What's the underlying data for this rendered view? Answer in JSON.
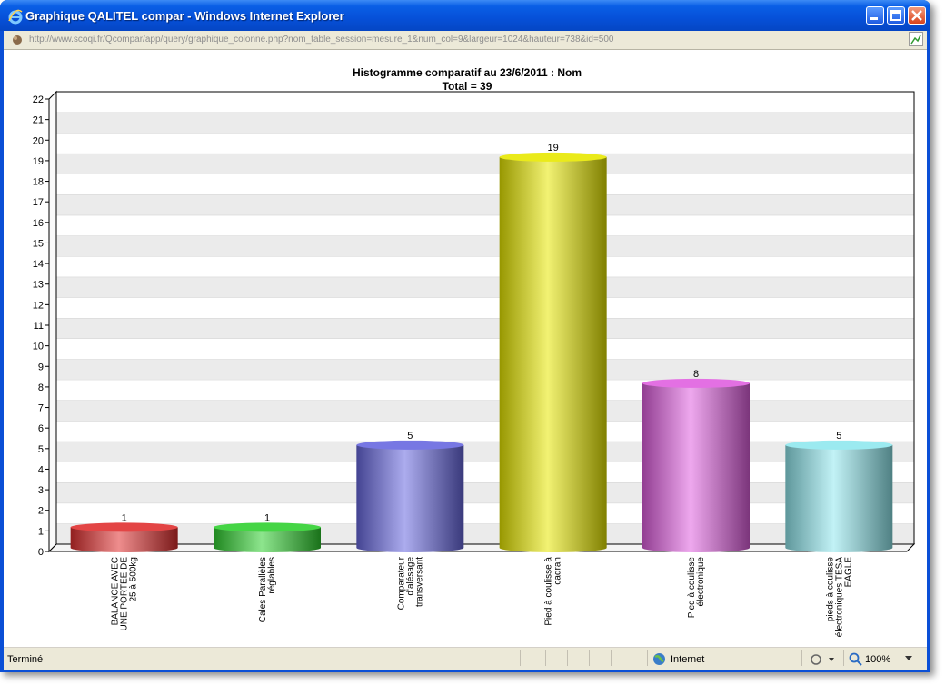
{
  "window": {
    "title": "Graphique QALITEL compar - Windows Internet Explorer",
    "url": "http://www.scoqi.fr/Qcompar/app/query/graphique_colonne.php?nom_table_session=mesure_1&num_col=9&largeur=1024&hauteur=738&id=500"
  },
  "status": {
    "text": "Terminé",
    "zone": "Internet",
    "zoom": "100%"
  },
  "colors": {
    "titlebar": "#0650d8",
    "stripe": "#ebebeb"
  },
  "chart_data": {
    "type": "bar",
    "title": "Histogramme comparatif au 23/6/2011 :  Nom",
    "subtitle": "Total = 39",
    "categories": [
      [
        "BALANCE AVEC",
        "UNE PORTEE DE",
        "25 à 500kg"
      ],
      [
        "Cales Parallèles",
        "réglables"
      ],
      [
        "Comparateur",
        "d'alésage",
        "transversant"
      ],
      [
        "Pied à coulisse à",
        "cadran"
      ],
      [
        "Pied à coulisse",
        "électronique"
      ],
      [
        "pieds à coulisse",
        "électroniques TESA",
        "EAGLE"
      ]
    ],
    "values": [
      1,
      1,
      5,
      19,
      8,
      5
    ],
    "value_labels": [
      "1",
      "1",
      "5",
      "19",
      "8",
      "5"
    ],
    "colors": [
      "#e03030",
      "#30d030",
      "#6868e0",
      "#e8e800",
      "#e060e0",
      "#90e8ee"
    ],
    "ylim": [
      0,
      22
    ],
    "yticks": [
      "0",
      "1",
      "2",
      "3",
      "4",
      "5",
      "6",
      "7",
      "8",
      "9",
      "10",
      "11",
      "12",
      "13",
      "14",
      "15",
      "16",
      "17",
      "18",
      "19",
      "20",
      "21",
      "22"
    ],
    "grid": true
  }
}
